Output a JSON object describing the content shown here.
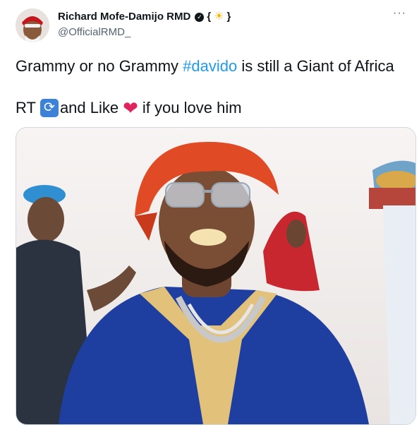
{
  "author": {
    "display_name": "Richard Mofe-Damijo RMD",
    "verified_icon": "verified-badge-icon",
    "name_open_brace": "{",
    "name_close_brace": "}",
    "name_emoji": "☀",
    "handle": "@OfficialRMD_"
  },
  "tweet": {
    "line1_prefix": "Grammy or no Grammy ",
    "hashtag": "#davido",
    "line1_suffix": " is still a Giant of Africa",
    "line2_start": "RT",
    "line2_middle": "and Like",
    "line2_end": "if you love him"
  },
  "menu": {
    "more_label": "···"
  },
  "media": {
    "icon": "photo"
  },
  "colors": {
    "link": "#1d9bf0",
    "secondary_text": "#536471",
    "primary_text": "#0f1419",
    "heart": "#e0245e"
  }
}
